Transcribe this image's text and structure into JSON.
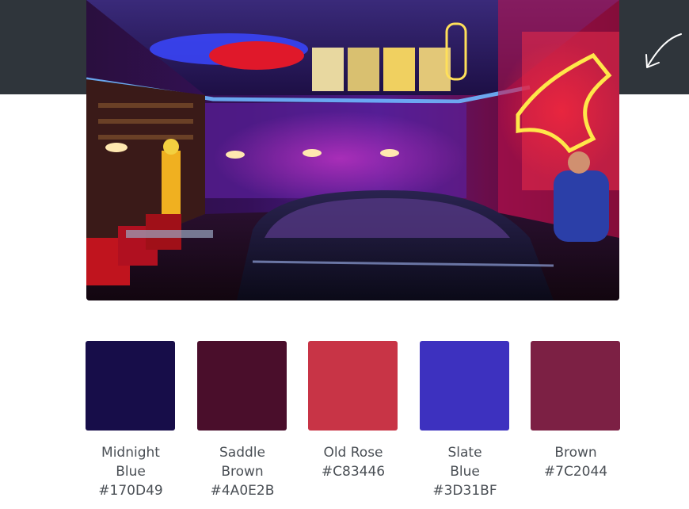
{
  "photo": {
    "alt_icon": "diner-photo"
  },
  "decor": {
    "arrow_icon": "curved-arrow-down-left-icon"
  },
  "palette": [
    {
      "name": "Midnight Blue",
      "hex": "#170D49",
      "color": "#170D49"
    },
    {
      "name": "Saddle Brown",
      "hex": "#4A0E2B",
      "color": "#4A0E2B"
    },
    {
      "name": "Old Rose",
      "hex": "#C83446",
      "color": "#C83446"
    },
    {
      "name": "Slate Blue",
      "hex": "#3D31BF",
      "color": "#3D31BF"
    },
    {
      "name": "Brown",
      "hex": "#7C2044",
      "color": "#7C2044"
    }
  ]
}
